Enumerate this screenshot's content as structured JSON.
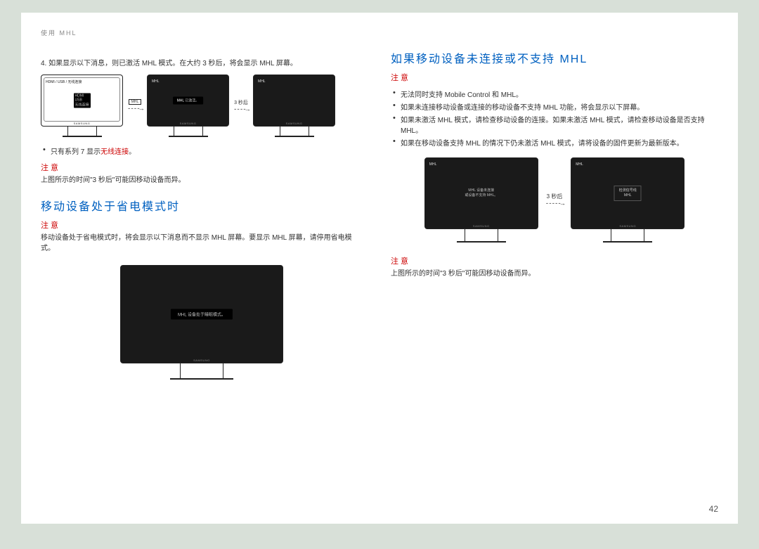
{
  "breadcrumb": "使用 MHL",
  "pageNumber": "42",
  "brand": "SAMSUNG",
  "left": {
    "step4": "4. 如果显示以下消息，则已激活 MHL 模式。在大约 3 秒后，将会显示 MHL 屏幕。",
    "mon1_topleft": "HDMI / USB / 无线连接",
    "mon2_topleft": "MHL",
    "mon2_pill_white": "MHL",
    "mon2_pill_rest": " 已激活。",
    "mon3_topleft": "MHL",
    "arrow1_label": "MHL",
    "arrow2_label": "3 秒后",
    "bullet1_pre": "只有系列 7 显示",
    "bullet1_red": "无线连接",
    "bullet1_post": "。",
    "notice1": "注意",
    "note1_body": "上图所示的时间\"3 秒后\"可能因移动设备而异。",
    "heading2": "移动设备处于省电模式时",
    "notice2": "注意",
    "note2_body": "移动设备处于省电模式时，将会显示以下消息而不显示 MHL 屏幕。要显示 MHL 屏幕，请停用省电模式。",
    "bigmon_pill": "MHL 设备处于睡眠模式。"
  },
  "right": {
    "heading": "如果移动设备未连接或不支持 MHL",
    "notice1": "注意",
    "b1": "无法同时支持 Mobile Control 和 MHL。",
    "b2": "如果未连接移动设备或连接的移动设备不支持 MHL 功能，将会显示以下屏幕。",
    "b3": "如果未激活 MHL 模式，请检查移动设备的连接。如果未激活 MHL 模式，请检查移动设备是否支持 MHL。",
    "b4": "如果在移动设备支持 MHL 的情况下仍未激活 MHL 模式，请将设备的固件更新为最新版本。",
    "mon1_topleft": "MHL",
    "mon1_line1": "MHL 设备未连接",
    "mon1_line2": "或设备不支持 MHL。",
    "arrow_label": "3 秒后",
    "mon2_topleft": "MHL",
    "mon2_box_l1": "检测信号线",
    "mon2_box_l2": "MHL",
    "notice2": "注意",
    "note2_body": "上图所示的时间\"3 秒后\"可能因移动设备而异。"
  }
}
